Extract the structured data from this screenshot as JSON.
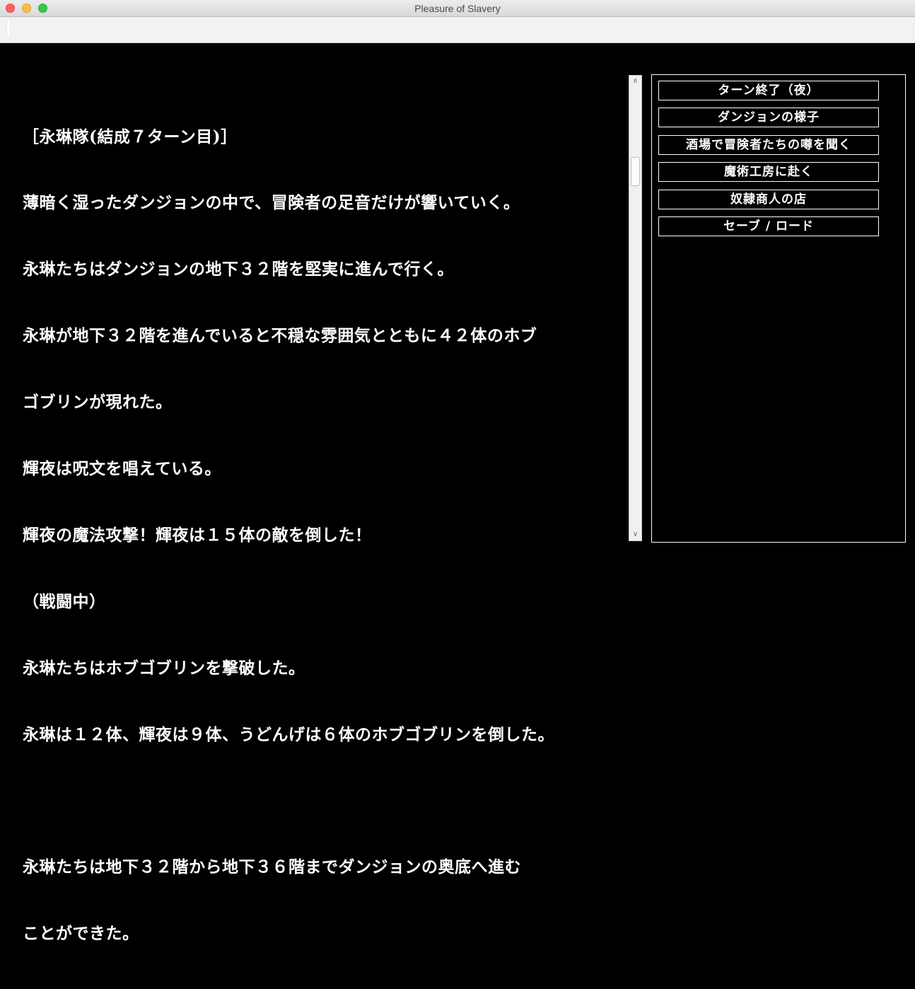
{
  "window": {
    "title": "Pleasure of Slavery"
  },
  "log": [
    "［永琳隊(結成７ターン目)］",
    "薄暗く湿ったダンジョンの中で、冒険者の足音だけが響いていく。",
    "永琳たちはダンジョンの地下３２階を堅実に進んで行く。",
    "永琳が地下３２階を進んでいると不穏な雰囲気とともに４２体のホブ",
    "ゴブリンが現れた。",
    "輝夜は呪文を唱えている。",
    "輝夜の魔法攻撃！輝夜は１５体の敵を倒した！",
    "（戦闘中）",
    "永琳たちはホブゴブリンを撃破した。",
    "永琳は１２体、輝夜は９体、うどんげは６体のホブゴブリンを倒した。",
    "",
    "永琳たちは地下３２階から地下３６階までダンジョンの奥底へ進む",
    "ことができた。"
  ],
  "commands": [
    "ターン終了（夜）",
    "ダンジョンの様子",
    "酒場で冒険者たちの噂を聞く",
    "魔術工房に赴く",
    "奴隷商人の店",
    "セーブ / ロード"
  ],
  "colors": {
    "background": "#000000",
    "text": "#ffffff"
  }
}
